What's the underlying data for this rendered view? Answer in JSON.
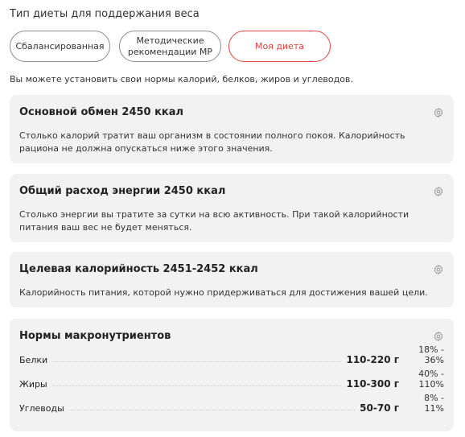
{
  "section_title": "Тип диеты для поддержания веса",
  "diet_tabs": [
    {
      "label": "Сбалансированная"
    },
    {
      "label": "Методические\nрекомендации МР"
    },
    {
      "label": "Моя диета"
    }
  ],
  "hint": "Вы можете установить свои нормы калорий, белков, жиров и углеводов.",
  "cards": [
    {
      "title": "Основной обмен 2450 ккал",
      "description": "Столько калорий тратит ваш организм в состоянии полного покоя. Калорийность рациона не должна опускаться ниже этого значения."
    },
    {
      "title": "Общий расход энергии 2450 ккал",
      "description": "Столько энергии вы тратите за сутки на всю активность. При такой калорийности питания ваш вес не будет меняться."
    },
    {
      "title": "Целевая калорийность 2451-2452 ккал",
      "description": "Калорийность питания, которой нужно придерживаться для достижения вашей цели."
    }
  ],
  "macros": {
    "title": "Нормы макронутриентов",
    "rows": [
      {
        "label": "Белки",
        "amount": "110-220 г",
        "percent": "18% - 36%"
      },
      {
        "label": "Жиры",
        "amount": "110-300 г",
        "percent": "40% - 110%"
      },
      {
        "label": "Углеводы",
        "amount": "50-70 г",
        "percent": "8% - 11%"
      }
    ]
  },
  "icons": {
    "settings": "gear-icon"
  },
  "colors": {
    "active_accent": "#e0443c",
    "card_bg": "#f2f2f2"
  }
}
